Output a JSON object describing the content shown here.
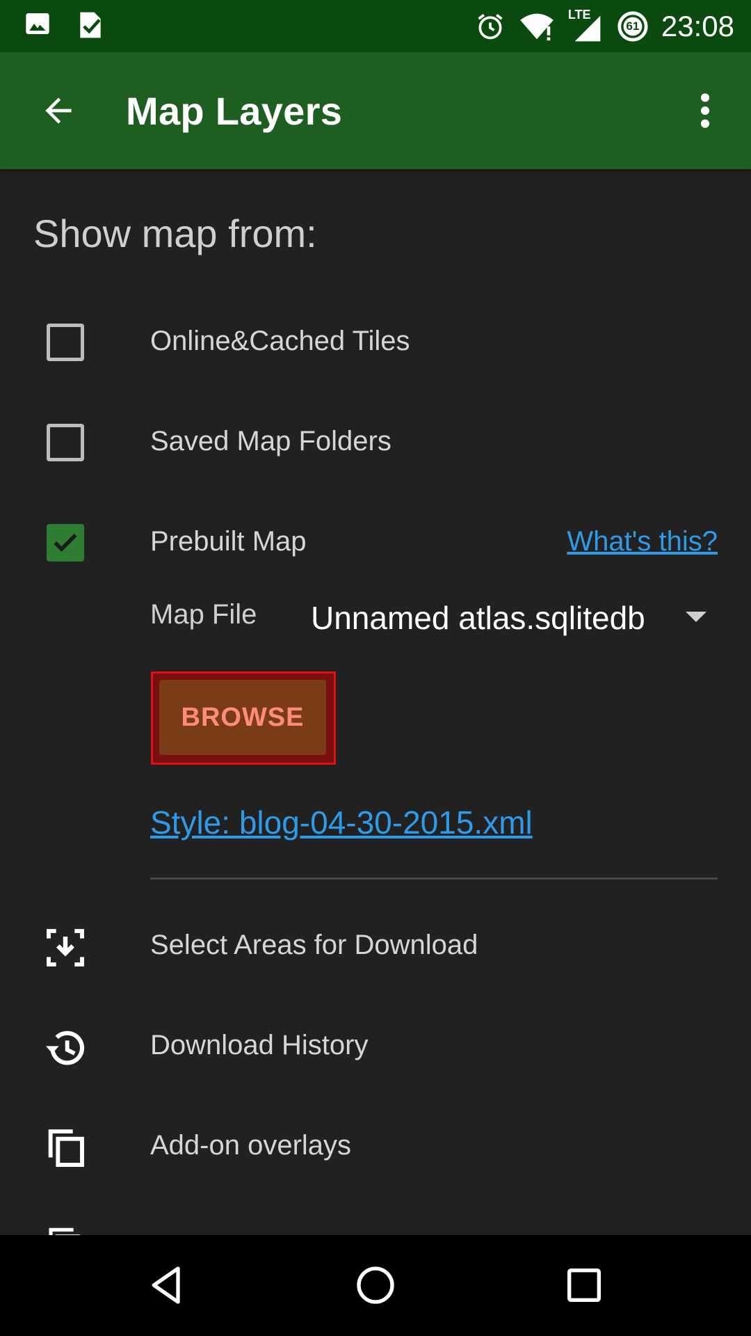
{
  "status_bar": {
    "time": "23:08",
    "battery_level": "61",
    "network_type": "LTE",
    "icons": [
      "image-icon",
      "task-check-icon",
      "alarm-icon",
      "wifi-icon",
      "lte-signal-icon",
      "battery-icon"
    ]
  },
  "app_bar": {
    "title": "Map Layers",
    "back_icon": "arrow-back-icon",
    "menu_icon": "more-vert-icon"
  },
  "section": {
    "title": "Show map from:"
  },
  "sources": [
    {
      "label": "Online&Cached Tiles",
      "checked": false
    },
    {
      "label": "Saved Map Folders",
      "checked": false
    },
    {
      "label": "Prebuilt Map",
      "checked": true,
      "link": "What's this?"
    }
  ],
  "map_file": {
    "label": "Map File",
    "value": "Unnamed atlas.sqlitedb"
  },
  "browse_button": {
    "label": "BROWSE"
  },
  "style_link": "Style: blog-04-30-2015.xml",
  "menu": [
    {
      "label": "Select Areas for Download",
      "icon": "download-area-icon"
    },
    {
      "label": "Download History",
      "icon": "history-icon"
    },
    {
      "label": "Add-on overlays",
      "icon": "copy-layers-icon"
    }
  ],
  "colors": {
    "status_bar": "#0b4a0e",
    "app_bar": "#1e5e20",
    "background": "#212121",
    "link": "#2e9be8",
    "checkbox_checked": "#2e7d32",
    "browse_text": "#ff8a80",
    "highlight_border": "#e01010"
  },
  "nav_bar": {
    "buttons": [
      "back-nav-icon",
      "home-nav-icon",
      "recents-nav-icon"
    ]
  }
}
